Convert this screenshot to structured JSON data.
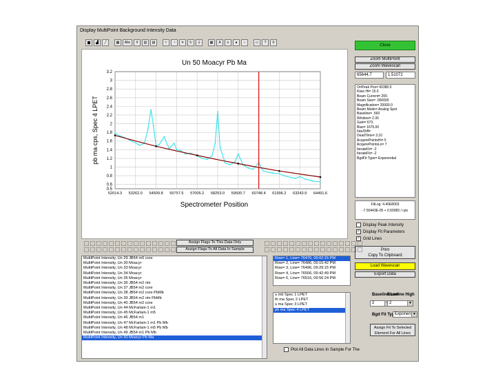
{
  "window": {
    "title": "Display MultiPoint Background Intensity Data"
  },
  "toolbar": {
    "icons": [
      "bar-chart-icon",
      "area-chart-icon",
      "line-chart-icon",
      "table-icon",
      "abc-label-icon",
      "grid-icon",
      "stacked-bar-icon",
      "chart-options-icon",
      "line-style-icon",
      "pie-icon",
      "symbol-icon",
      "rotate-icon",
      "axis-icon",
      "grid-lines-icon",
      "font-icon",
      "legend-icon",
      "palette-icon",
      "scale-icon",
      "copy-icon",
      "help-icon",
      "zoom-icon"
    ],
    "abc_label": "Abc"
  },
  "chart_data": {
    "type": "line",
    "title": "Un   50  Moacyr Pb Ma",
    "xlabel": "Spectrometer Position",
    "ylabel": "pb ma cps, Spec   4 LPET",
    "x_ticks": [
      "52014.3",
      "53262.0",
      "54509.8",
      "55757.5",
      "57005.2",
      "58253.0",
      "59500.7",
      "60748.4",
      "61996.2",
      "63243.9",
      "64491.6"
    ],
    "xlim": [
      52014.3,
      64491.6
    ],
    "y_ticks": [
      "0.5",
      "0.6",
      "0.8",
      "1",
      "1.2",
      "1.4",
      "1.6",
      "1.8",
      "2",
      "2.2",
      "2.4",
      "2.6",
      "2.8",
      "3",
      "3.2"
    ],
    "ylim": [
      0.5,
      3.2
    ],
    "grid": true,
    "series": [
      {
        "role": "measured",
        "color": "#33e0e8",
        "x": [
          52014.3,
          52300,
          52600,
          52900,
          53262,
          53500,
          53800,
          54000,
          54200,
          54350,
          54509.8,
          54700,
          55000,
          55300,
          55600,
          55757.5,
          56000,
          56300,
          56600,
          57005.2,
          57300,
          57600,
          57900,
          58100,
          58253,
          58400,
          58700,
          59000,
          59300,
          59500.7,
          59800,
          60100,
          60400,
          60748.4,
          61000,
          61300,
          61600,
          61996.2,
          62300,
          62700,
          63000,
          63243.9,
          63600,
          64000,
          64491.6
        ],
        "y": [
          1.78,
          1.72,
          1.68,
          1.62,
          1.56,
          1.5,
          1.55,
          1.85,
          2.32,
          1.95,
          1.48,
          1.52,
          1.7,
          1.42,
          1.55,
          1.4,
          1.38,
          1.3,
          1.32,
          1.26,
          1.2,
          1.18,
          1.25,
          1.55,
          2.28,
          1.45,
          1.1,
          1.05,
          1.12,
          1.3,
          1.05,
          0.98,
          0.95,
          1.1,
          0.92,
          0.88,
          0.86,
          0.85,
          0.8,
          0.76,
          0.74,
          0.78,
          0.72,
          0.68,
          0.66
        ]
      },
      {
        "role": "fit",
        "color": "#8b0000",
        "type": "exponential",
        "x": [
          52014.3,
          53262,
          54509.8,
          55757.5,
          57005.2,
          58253,
          59500.7,
          60748.4,
          61996.2,
          63243.9,
          64491.6
        ],
        "y": [
          1.73,
          1.6,
          1.48,
          1.37,
          1.27,
          1.17,
          1.08,
          0.99,
          0.91,
          0.84,
          0.77
        ]
      },
      {
        "role": "peak-position",
        "color": "#e02020",
        "x_value": 60748.4
      }
    ]
  },
  "right_panel": {
    "close": "Close",
    "zoom_multipoint": "Zoom MultiPoint",
    "zoom_wavescan": "Zoom Wavescan",
    "coord_x": "65644.7",
    "coord_y": "1.51072",
    "info_lines": [
      "OnPeak Pos= 60380.0",
      "Ktwo Ht= 15.0",
      "Beam Current= 200.",
      "Beam Size= .000000",
      "Magnification= 20000.0",
      "Beam Mode= Analog Spot",
      "Baseline= .560",
      "Window= 2.30",
      "Gain= 673.",
      "Bias= 1675.00",
      "Inte/Diff= ",
      "DeadTime= 3.10",
      "AcquirePointsHi= 5",
      "AcquirePointsLo= 7",
      "IterateFit= -2",
      "IterateFit= -2",
      "BgdFit Type= Exponential"
    ],
    "fit_label": "FitLog: 4.40E8003",
    "fit_equation": "-7.50443E-05 + 0.50083 / cps",
    "checks": [
      {
        "label": "Display Peak Intensity",
        "checked": false
      },
      {
        "label": "Display Fit Parameters",
        "checked": true
      },
      {
        "label": "Grid Lines",
        "checked": true
      }
    ],
    "print_line1": "Print",
    "print_line2": "Copy To Clipboard",
    "load_wavescan": "Load Wavescan",
    "export_data": "Export Data"
  },
  "middle": {
    "assign_flags_this": "Assign Flags To This Data Only",
    "assign_flags_all": "Assign Flags To All Data In Sample"
  },
  "data_list": {
    "items": [
      "MultiPoint Intensity, Un   29  JB54 m0 core",
      "MultiPoint Intensity, Un   30  Moacyr",
      "MultiPoint Intensity, Un   33  Moacyr",
      "MultiPoint Intensity, Un   34  Moacyr",
      "MultiPoint Intensity, Un   35  Moacyr",
      "MultiPoint Intensity, Un   36  JB54 m2 rim",
      "MultiPoint Intensity, Un   37  JB54 m2 core",
      "MultiPoint Intensity, Un   38  JB54 m2 core PbMb",
      "MultiPoint Intensity, Un   39  JB54 m2 rim PbMb",
      "MultiPoint Intensity, Un   40  JB54 m2 core",
      "MultiPoint Intensity, Un   44  McFarlain-1 m1",
      "MultiPoint Intensity, Un   45  McFarlain-1 m5",
      "MultiPoint Intensity, Un   46  JB54 m1",
      "MultiPoint Intensity, Un   47  McFarlain-1 m1 Pb Mb",
      "MultiPoint Intensity, Un   48  McFarlain-1 m5 Pb Mb",
      "MultiPoint Intensity, Un   49  JB54 m1 Pb Mb",
      "MultiPoint Intensity, Un   50  Moacyr Pb Ma"
    ],
    "selected": 16
  },
  "rows_list": {
    "items": [
      "Row= 1, Line= 76470, 09:02:15 PM",
      "Row= 2, Line= 76486, 09:15:42 PM",
      "Row= 3, Line= 76496, 09:29:15 PM",
      "Row= 4, Line= 76506, 09:42:49 PM",
      "Row= 5, Line= 76516, 09:56:24 PM"
    ],
    "selected": 0
  },
  "spec_list": {
    "items": [
      "u mb Spec  1 LPET",
      "th ma Spec  2 LPET",
      "u ma Spec  3 LPET",
      "pb ma Spec  4 LPET"
    ],
    "selected": 3
  },
  "baseline": {
    "low_label": "Baseline Low",
    "high_label": "Baseline High",
    "low_value": "2",
    "high_value": "2",
    "bgd_fit_label": "Bgd Fit Type",
    "bgd_fit_value": "Exponen",
    "assign_fit_line1": "Assign Fit To Selected",
    "assign_fit_line2": "Element For All Lines"
  },
  "bottom": {
    "plot_all": "Plot All Data Lines In Sample For The"
  }
}
